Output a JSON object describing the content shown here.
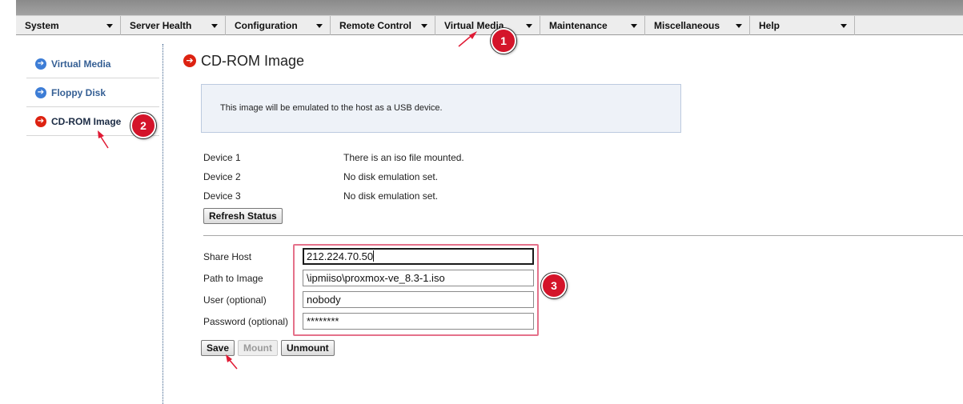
{
  "menu": {
    "items": [
      {
        "label": "System"
      },
      {
        "label": "Server Health"
      },
      {
        "label": "Configuration"
      },
      {
        "label": "Remote Control"
      },
      {
        "label": "Virtual Media"
      },
      {
        "label": "Maintenance"
      },
      {
        "label": "Miscellaneous"
      },
      {
        "label": "Help"
      }
    ]
  },
  "sidebar": {
    "items": [
      {
        "label": "Virtual Media",
        "icon": "arrow-right-circle-icon",
        "color": "#3d7dd6"
      },
      {
        "label": "Floppy Disk",
        "icon": "arrow-right-circle-icon",
        "color": "#3d7dd6"
      },
      {
        "label": "CD-ROM Image",
        "icon": "arrow-right-circle-icon",
        "color": "#dd2211",
        "active": true
      }
    ]
  },
  "page": {
    "title": "CD-ROM Image",
    "info": "This image will be emulated to the host as a USB device."
  },
  "devices": [
    {
      "label": "Device 1",
      "status": "There is an iso file mounted."
    },
    {
      "label": "Device 2",
      "status": "No disk emulation set."
    },
    {
      "label": "Device 3",
      "status": "No disk emulation set."
    }
  ],
  "buttons": {
    "refresh": "Refresh Status",
    "save": "Save",
    "mount": "Mount",
    "unmount": "Unmount"
  },
  "form": {
    "share_host": {
      "label": "Share Host",
      "value": "212.224.70.50"
    },
    "path": {
      "label": "Path to Image",
      "value": "\\ipmiiso\\proxmox-ve_8.3-1.iso"
    },
    "user": {
      "label": "User (optional)",
      "value": "nobody"
    },
    "password": {
      "label": "Password (optional)",
      "value": "********"
    }
  },
  "annotations": {
    "badge1": "1",
    "badge2": "2",
    "badge3": "3"
  },
  "colors": {
    "accent_red": "#d4142a",
    "link_blue": "#355f94"
  }
}
